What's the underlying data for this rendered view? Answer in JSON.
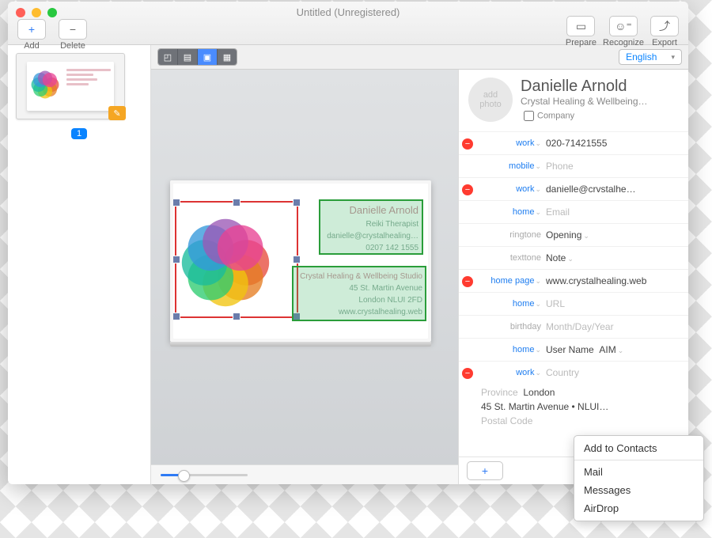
{
  "window": {
    "title": "Untitled (Unregistered)"
  },
  "toolbar": {
    "add": "Add",
    "delete": "Delete",
    "prepare": "Prepare",
    "recognize": "Recognize",
    "export": "Export"
  },
  "sidebar": {
    "page_badge": "1"
  },
  "viewbar": {
    "language": "English"
  },
  "card": {
    "name": "Danielle Arnold",
    "role": "Reiki Therapist",
    "email": "danielle@crystalhealing…",
    "phone": "0207 142 1555",
    "studio": "Crystal Healing & Wellbeing Studio",
    "addr1": "45 St. Martin Avenue",
    "addr2": "London NLUI 2FD",
    "url": "www.crystalhealing.web"
  },
  "contact": {
    "avatar_label": "add\nphoto",
    "name": "Danielle Arnold",
    "org": "Crystal Healing & Wellbeing…",
    "company_label": "Company",
    "fields": {
      "phone_work_label": "work",
      "phone_work_value": "020-71421555",
      "phone_mobile_label": "mobile",
      "phone_mobile_ph": "Phone",
      "email_work_label": "work",
      "email_work_value": "danielle@crvstalhe…",
      "email_home_label": "home",
      "email_home_ph": "Email",
      "ringtone_label": "ringtone",
      "ringtone_value": "Opening",
      "texttone_label": "texttone",
      "texttone_value": "Note",
      "homepage_label": "home page",
      "homepage_value": "www.crystalhealing.web",
      "url_home_label": "home",
      "url_home_ph": "URL",
      "birthday_label": "birthday",
      "birthday_ph": "Month/Day/Year",
      "im_home_label": "home",
      "im_ph": "User Name",
      "im_service": "AIM",
      "addr_work_label": "work",
      "addr_country_ph": "Country",
      "addr_province_label": "Province",
      "addr_province_value": "London",
      "addr_street": "45 St. Martin Avenue •  NLUI…",
      "addr_postal_ph": "Postal Code"
    }
  },
  "share_menu": {
    "add_to_contacts": "Add to Contacts",
    "mail": "Mail",
    "messages": "Messages",
    "airdrop": "AirDrop"
  }
}
